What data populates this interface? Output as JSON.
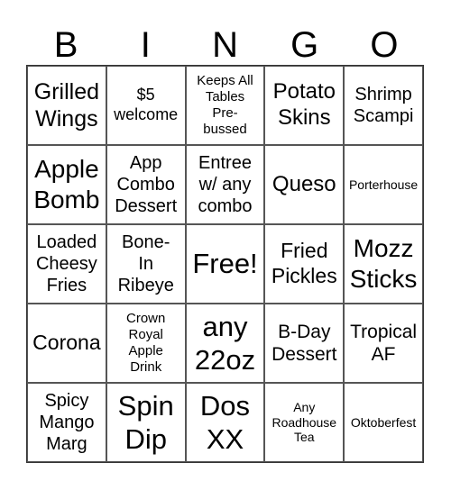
{
  "header": [
    "B",
    "I",
    "N",
    "G",
    "O"
  ],
  "cells": [
    "Grilled\nWings",
    "$5\nwelcome",
    "Keeps All\nTables\nPre-\nbussed",
    "Potato\nSkins",
    "Shrimp\nScampi",
    "Apple\nBomb",
    "App\nCombo\nDessert",
    "Entree\nw/ any\ncombo",
    "Queso",
    "Porterhouse",
    "Loaded\nCheesy\nFries",
    "Bone-\nIn\nRibeye",
    "Free!",
    "Fried\nPickles",
    "Mozz\nSticks",
    "Corona",
    "Crown\nRoyal\nApple\nDrink",
    "any\n22oz",
    "B-Day\nDessert",
    "Tropical\nAF",
    "Spicy\nMango\nMarg",
    "Spin\nDip",
    "Dos\nXX",
    "Any\nRoadhouse\nTea",
    "Oktoberfest"
  ]
}
